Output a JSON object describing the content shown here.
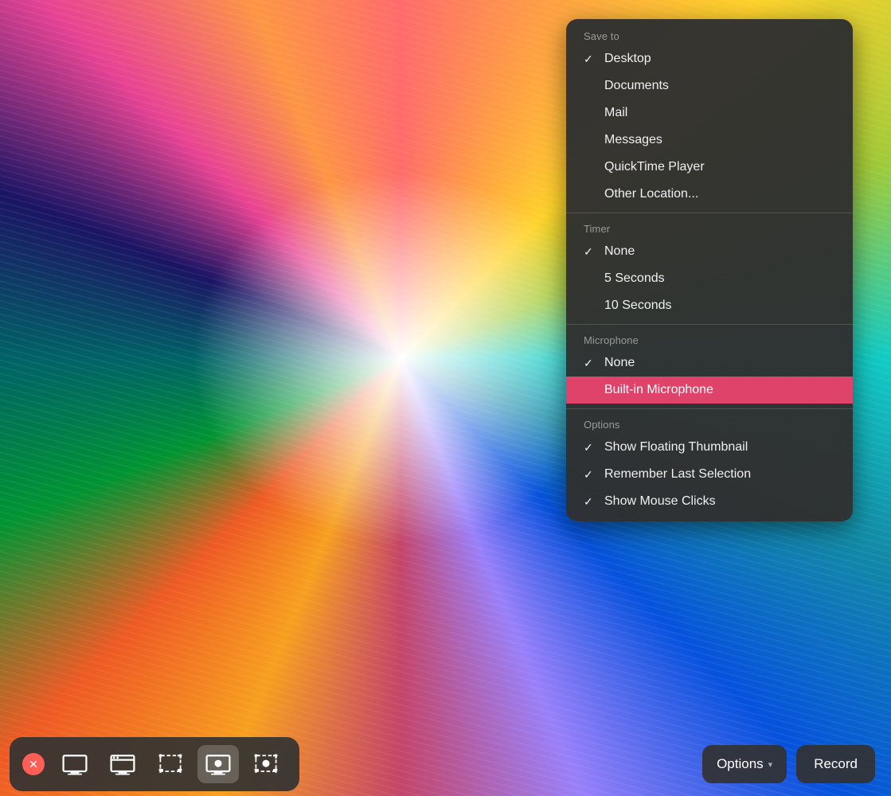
{
  "background": {
    "alt": "Colorful streaks wallpaper"
  },
  "dropdown": {
    "save_to_label": "Save to",
    "save_to_items": [
      {
        "id": "desktop",
        "label": "Desktop",
        "checked": true
      },
      {
        "id": "documents",
        "label": "Documents",
        "checked": false
      },
      {
        "id": "mail",
        "label": "Mail",
        "checked": false
      },
      {
        "id": "messages",
        "label": "Messages",
        "checked": false
      },
      {
        "id": "quicktime",
        "label": "QuickTime Player",
        "checked": false
      },
      {
        "id": "other",
        "label": "Other Location...",
        "checked": false
      }
    ],
    "timer_label": "Timer",
    "timer_items": [
      {
        "id": "none",
        "label": "None",
        "checked": true
      },
      {
        "id": "5sec",
        "label": "5 Seconds",
        "checked": false
      },
      {
        "id": "10sec",
        "label": "10 Seconds",
        "checked": false
      }
    ],
    "microphone_label": "Microphone",
    "microphone_items": [
      {
        "id": "mic-none",
        "label": "None",
        "checked": true
      },
      {
        "id": "builtin",
        "label": "Built-in Microphone",
        "checked": false,
        "highlighted": true
      }
    ],
    "options_label": "Options",
    "options_items": [
      {
        "id": "floating-thumbnail",
        "label": "Show Floating Thumbnail",
        "checked": true
      },
      {
        "id": "remember-selection",
        "label": "Remember Last Selection",
        "checked": true
      },
      {
        "id": "show-mouse",
        "label": "Show Mouse Clicks",
        "checked": true
      }
    ]
  },
  "toolbar": {
    "close_label": "✕",
    "capture_full_label": "Capture Full Screen",
    "capture_window_label": "Capture Window",
    "capture_selection_label": "Capture Selection",
    "capture_full_video_label": "Capture Full Screen Video",
    "capture_selection_video_label": "Capture Selection Video",
    "options_btn_label": "Options",
    "record_btn_label": "Record",
    "chevron": "▾"
  }
}
